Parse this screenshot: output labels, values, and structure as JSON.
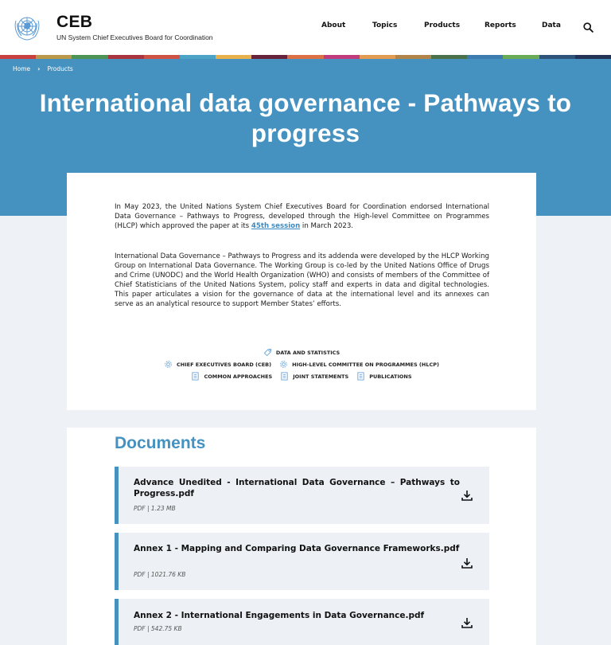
{
  "header": {
    "brand_title": "CEB",
    "brand_subtitle": "UN System Chief Executives Board for Coordination",
    "nav": [
      "About",
      "Topics",
      "Products",
      "Reports",
      "Data"
    ],
    "search_icon": "search-icon"
  },
  "stripe_colors": [
    "#c9413f",
    "#b9984a",
    "#4d9356",
    "#a9353f",
    "#cf5344",
    "#4ba3c6",
    "#e7b24d",
    "#67233a",
    "#db7044",
    "#c03c7c",
    "#e39a51",
    "#b1854a",
    "#49714a",
    "#3d7cae",
    "#6aab57",
    "#2f5479",
    "#233456"
  ],
  "breadcrumb": {
    "items": [
      "Home",
      "Products"
    ],
    "separator": "›"
  },
  "page": {
    "title": "International data governance - Pathways to progress",
    "intro": {
      "p1_before": "In May 2023, the United Nations System Chief Executives Board for Coordination endorsed International Data Governance – Pathways to Progress, developed through the High-level Committee on Programmes (HLCP) which approved the paper at its ",
      "p1_link": "45th session",
      "p1_after": " in March 2023.",
      "p2": "International Data Governance – Pathways to Progress and its addenda were developed by the HLCP Working Group on International Data Governance. The Working Group is co-led by the United Nations Office of Drugs and Crime (UNODC) and the World Health Organization (WHO) and consists of members of the Committee of Chief Statisticians of the United Nations System, policy staff and experts in data and digital technologies. This paper articulates a vision for the governance of data at the international level and its annexes can serve as an analytical resource to support Member States’ efforts."
    },
    "tags": {
      "topic": {
        "label": "DATA AND STATISTICS",
        "icon": "tag-icon"
      },
      "bodies": [
        {
          "label": "CHIEF EXECUTIVES BOARD (CEB)",
          "icon": "gear-icon"
        },
        {
          "label": "HIGH-LEVEL COMMITTEE ON PROGRAMMES (HLCP)",
          "icon": "gear-icon"
        }
      ],
      "types": [
        {
          "label": "COMMON APPROACHES",
          "icon": "document-icon"
        },
        {
          "label": "JOINT STATEMENTS",
          "icon": "document-icon"
        },
        {
          "label": "PUBLICATIONS",
          "icon": "document-icon"
        }
      ]
    }
  },
  "documents": {
    "heading": "Documents",
    "items": [
      {
        "title": "Advance Unedited - International Data Governance – Pathways to Progress.pdf",
        "meta": "PDF | 1.23 MB",
        "icon": "download-icon"
      },
      {
        "title": "Annex 1 - Mapping and Comparing Data Governance Frameworks.pdf",
        "meta": "PDF | 1021.76 KB",
        "icon": "download-icon"
      },
      {
        "title": "Annex 2 - International Engagements in Data Governance.pdf",
        "meta": "PDF | 542.75 KB",
        "icon": "download-icon"
      }
    ]
  },
  "colors": {
    "brand_blue": "#4592c1",
    "link_blue": "#3a89c0",
    "page_bg": "#eef2f6",
    "doc_bg": "#edf1f5"
  }
}
